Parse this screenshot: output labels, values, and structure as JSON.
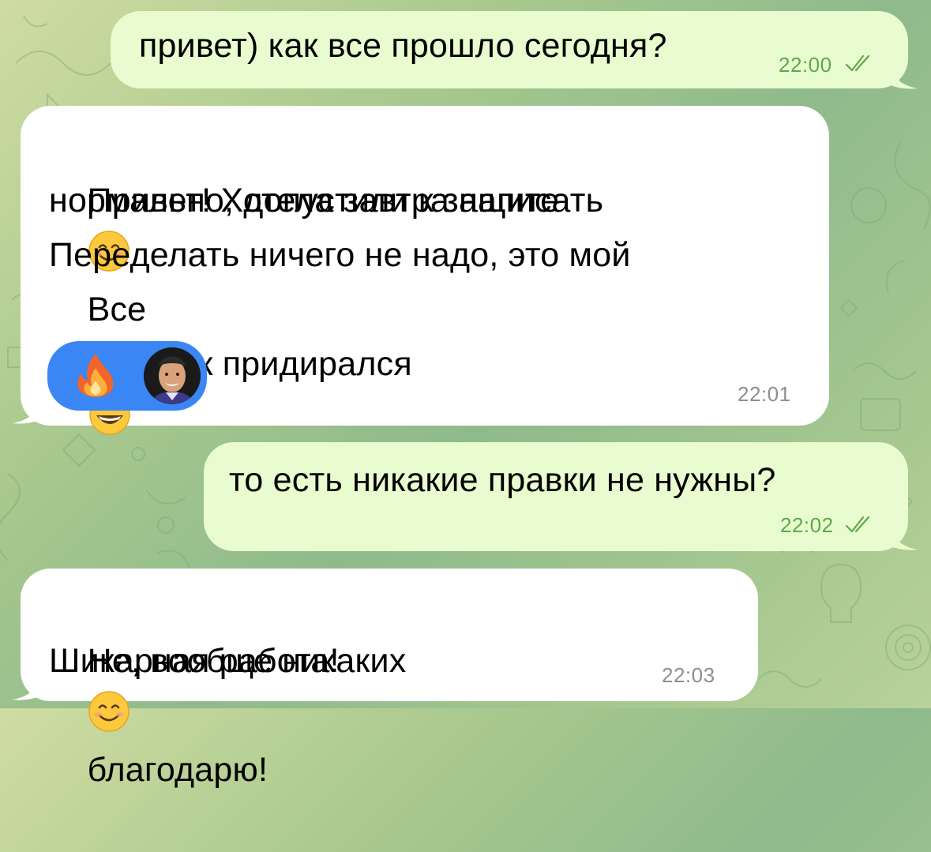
{
  "chat": {
    "messages": [
      {
        "direction": "outgoing",
        "text": "привет) как все прошло сегодня?",
        "time": "22:00",
        "status": "read"
      },
      {
        "direction": "incoming",
        "lines": [
          "Привет! Хотела завтра написать",
          "Все",
          "нормально, допустили к защите",
          "Переделать ничего не надо, это мой",
          "научник придирался"
        ],
        "emojis": [
          "smiling-face-emoji",
          "grinning-sweat-emoji"
        ],
        "time": "22:01",
        "reaction": {
          "emoji": "fire-emoji",
          "reactor": "avatar"
        }
      },
      {
        "direction": "outgoing",
        "text": "то есть никакие правки не нужны?",
        "time": "22:02",
        "status": "read"
      },
      {
        "direction": "incoming",
        "lines": [
          "Не, вообще никаких",
          "благодарю!",
          "Шикарная работа!"
        ],
        "emojis": [
          "smiling-face-emoji"
        ],
        "time": "22:03"
      }
    ]
  },
  "colors": {
    "outgoing_bubble": "#e8fccf",
    "incoming_bubble": "#ffffff",
    "outgoing_time": "#5fa84a",
    "incoming_time": "#8e8e93",
    "reaction_pill": "#3a86f5"
  }
}
